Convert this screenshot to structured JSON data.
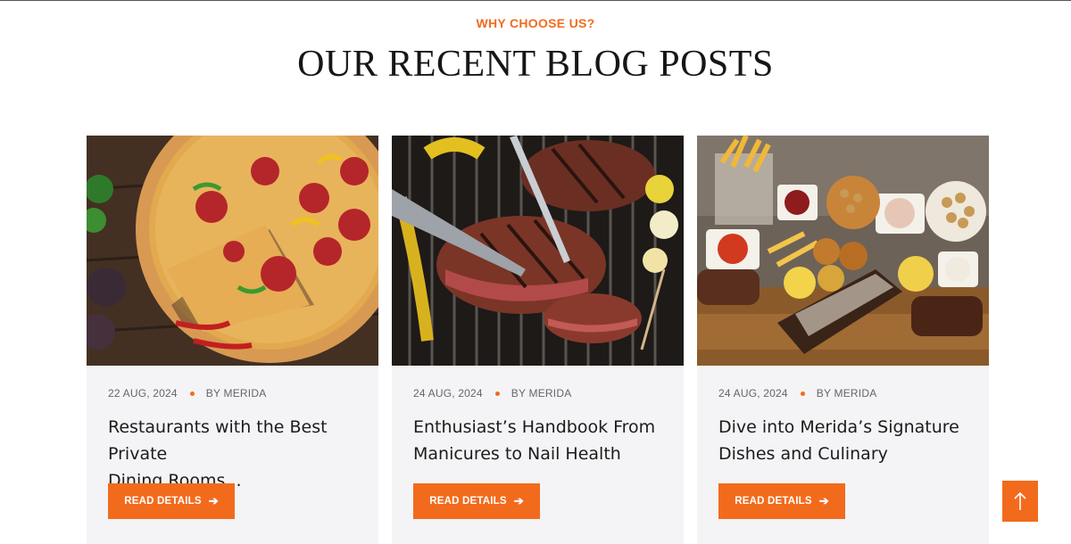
{
  "section": {
    "eyebrow": "WHY CHOOSE US?",
    "heading": "OUR RECENT BLOG POSTS"
  },
  "posts": [
    {
      "image": "pizza-photo",
      "date": "22 AUG, 2024",
      "author": "BY MERIDA",
      "title_line1": "Restaurants with the Best Private",
      "title_line2": "Dining Rooms...",
      "button_label": "READ DETAILS",
      "button_icon": "arrow-right-icon"
    },
    {
      "image": "grilled-steak-photo",
      "date": "24 AUG, 2024",
      "author": "BY MERIDA",
      "title_line1": "Enthusiast’s Handbook From",
      "title_line2": "Manicures to Nail Health",
      "button_label": "READ DETAILS",
      "button_icon": "arrow-right-icon"
    },
    {
      "image": "appetizer-platter-photo",
      "date": "24 AUG, 2024",
      "author": "BY MERIDA",
      "title_line1": "Dive into Merida’s Signature",
      "title_line2": "Dishes and Culinary",
      "button_label": "READ DETAILS",
      "button_icon": "arrow-right-icon"
    }
  ],
  "scroll_to_top": {
    "icon": "arrow-up-icon"
  },
  "colors": {
    "accent": "#f26b1d",
    "card_bg": "#f4f4f6",
    "heading": "#161616"
  }
}
